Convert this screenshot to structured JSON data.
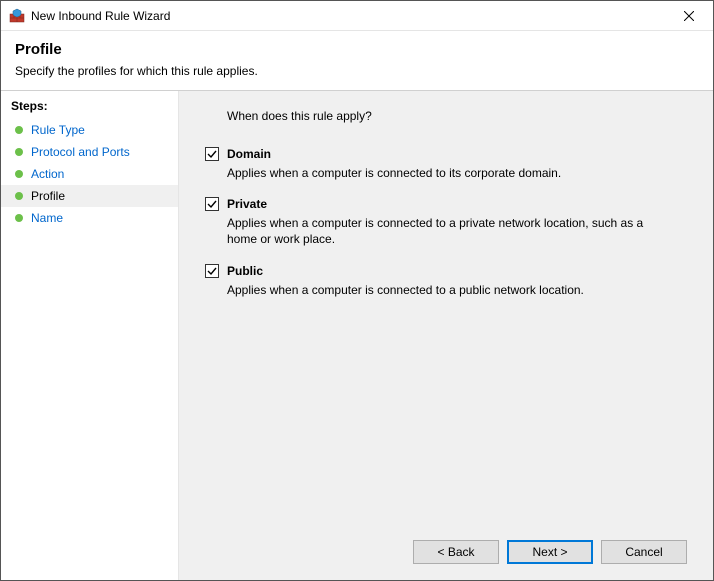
{
  "window": {
    "title": "New Inbound Rule Wizard"
  },
  "header": {
    "title": "Profile",
    "subtitle": "Specify the profiles for which this rule applies."
  },
  "sidebar": {
    "title": "Steps:",
    "items": [
      {
        "label": "Rule Type",
        "current": false
      },
      {
        "label": "Protocol and Ports",
        "current": false
      },
      {
        "label": "Action",
        "current": false
      },
      {
        "label": "Profile",
        "current": true
      },
      {
        "label": "Name",
        "current": false
      }
    ]
  },
  "main": {
    "question": "When does this rule apply?",
    "options": [
      {
        "key": "domain",
        "label": "Domain",
        "description": "Applies when a computer is connected to its corporate domain.",
        "checked": true
      },
      {
        "key": "private",
        "label": "Private",
        "description": "Applies when a computer is connected to a private network location, such as a home or work place.",
        "checked": true
      },
      {
        "key": "public",
        "label": "Public",
        "description": "Applies when a computer is connected to a public network location.",
        "checked": true
      }
    ]
  },
  "footer": {
    "back": "< Back",
    "next": "Next >",
    "cancel": "Cancel"
  }
}
